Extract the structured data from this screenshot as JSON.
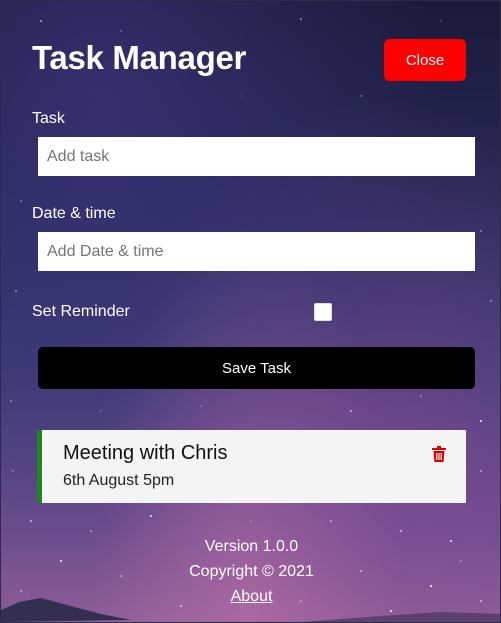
{
  "header": {
    "title": "Task Manager",
    "close_label": "Close"
  },
  "form": {
    "task_label": "Task",
    "task_placeholder": "Add task",
    "task_value": "",
    "datetime_label": "Date & time",
    "datetime_placeholder": "Add Date & time",
    "datetime_value": "",
    "reminder_label": "Set Reminder",
    "reminder_checked": false,
    "save_label": "Save Task"
  },
  "tasks": [
    {
      "title": "Meeting with Chris",
      "time": "6th August 5pm",
      "reminder": true,
      "delete_icon": "trash-icon"
    }
  ],
  "footer": {
    "version": "Version 1.0.0",
    "copyright": "Copyright © 2021",
    "about_label": "About"
  },
  "colors": {
    "close_button": "#ff0000",
    "save_button": "#000000",
    "reminder_border": "#1a8a1a",
    "trash_icon": "#e00000"
  }
}
